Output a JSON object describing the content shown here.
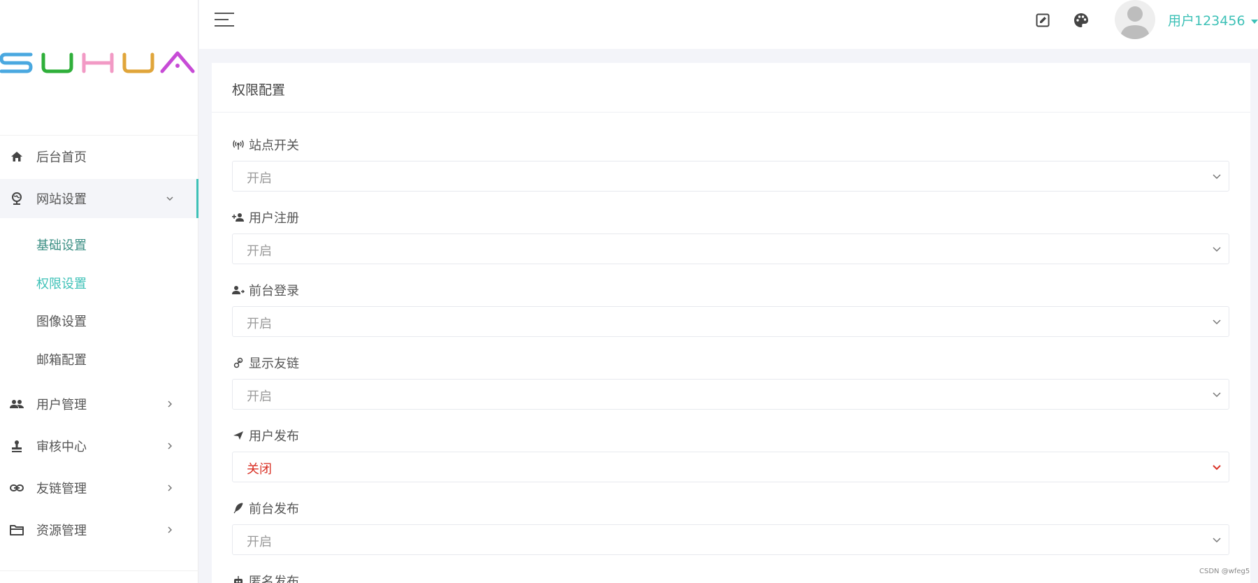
{
  "logo": {
    "text": "SUHUA"
  },
  "sidebar": {
    "items": [
      {
        "label": "后台首页",
        "icon": "home-icon"
      },
      {
        "label": "网站设置",
        "icon": "globe-icon",
        "expanded": true
      },
      {
        "label": "用户管理",
        "icon": "users-icon"
      },
      {
        "label": "审核中心",
        "icon": "stamp-icon"
      },
      {
        "label": "友链管理",
        "icon": "link-icon"
      },
      {
        "label": "资源管理",
        "icon": "folder-icon"
      }
    ],
    "sub_items": [
      {
        "label": "基础设置"
      },
      {
        "label": "权限设置"
      },
      {
        "label": "图像设置"
      },
      {
        "label": "邮箱配置"
      }
    ]
  },
  "header": {
    "username": "用户123456",
    "accent_color": "#3ec1b7"
  },
  "main": {
    "title": "权限配置",
    "fields": [
      {
        "label": "站点开关",
        "value": "开启",
        "icon": "broadcast-icon"
      },
      {
        "label": "用户注册",
        "value": "开启",
        "icon": "user-plus-icon"
      },
      {
        "label": "前台登录",
        "value": "开启",
        "icon": "user-login-icon"
      },
      {
        "label": "显示友链",
        "value": "开启",
        "icon": "link-icon"
      },
      {
        "label": "用户发布",
        "value": "关闭",
        "icon": "send-icon"
      },
      {
        "label": "前台发布",
        "value": "开启",
        "icon": "feather-icon"
      },
      {
        "label": "匿名发布",
        "value": "",
        "icon": "robot-icon"
      }
    ]
  },
  "watermark": "CSDN @wfeg5"
}
